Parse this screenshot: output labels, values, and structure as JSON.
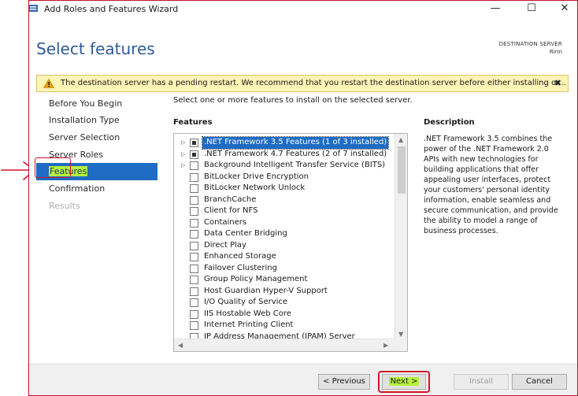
{
  "window": {
    "title": "Add Roles and Features Wizard",
    "minimize": "—",
    "maximize": "☐",
    "close": "✕"
  },
  "header": {
    "page_title": "Select features",
    "destination_label": "DESTINATION SERVER",
    "destination_name": "Ririn"
  },
  "warning": {
    "text": "The destination server has a pending restart. We recommend that you restart the destination server before either installing or...",
    "close": "✖"
  },
  "nav": {
    "items": [
      {
        "label": "Before You Begin",
        "state": "normal"
      },
      {
        "label": "Installation Type",
        "state": "normal"
      },
      {
        "label": "Server Selection",
        "state": "normal"
      },
      {
        "label": "Server Roles",
        "state": "normal"
      },
      {
        "label": "Features",
        "state": "active"
      },
      {
        "label": "Confirmation",
        "state": "normal"
      },
      {
        "label": "Results",
        "state": "disabled"
      }
    ]
  },
  "main": {
    "instruction": "Select one or more features to install on the selected server.",
    "features_header": "Features",
    "description_header": "Description",
    "description": ".NET Framework 3.5 combines the power of the .NET Framework 2.0 APIs with new technologies for building applications that offer appealing user interfaces, protect your customers' personal identity information, enable seamless and secure communication, and provide the ability to model a range of business processes.",
    "features": [
      {
        "label": ".NET Framework 3.5 Features (1 of 3 installed)",
        "expandable": true,
        "check": "partial",
        "selected": true
      },
      {
        "label": ".NET Framework 4.7 Features (2 of 7 installed)",
        "expandable": true,
        "check": "partial",
        "selected": false
      },
      {
        "label": "Background Intelligent Transfer Service (BITS)",
        "expandable": true,
        "check": "none",
        "selected": false
      },
      {
        "label": "BitLocker Drive Encryption",
        "expandable": false,
        "check": "none",
        "selected": false
      },
      {
        "label": "BitLocker Network Unlock",
        "expandable": false,
        "check": "none",
        "selected": false
      },
      {
        "label": "BranchCache",
        "expandable": false,
        "check": "none",
        "selected": false
      },
      {
        "label": "Client for NFS",
        "expandable": false,
        "check": "none",
        "selected": false
      },
      {
        "label": "Containers",
        "expandable": false,
        "check": "none",
        "selected": false
      },
      {
        "label": "Data Center Bridging",
        "expandable": false,
        "check": "none",
        "selected": false
      },
      {
        "label": "Direct Play",
        "expandable": false,
        "check": "none",
        "selected": false
      },
      {
        "label": "Enhanced Storage",
        "expandable": false,
        "check": "none",
        "selected": false
      },
      {
        "label": "Failover Clustering",
        "expandable": false,
        "check": "none",
        "selected": false
      },
      {
        "label": "Group Policy Management",
        "expandable": false,
        "check": "none",
        "selected": false
      },
      {
        "label": "Host Guardian Hyper-V Support",
        "expandable": false,
        "check": "none",
        "selected": false
      },
      {
        "label": "I/O Quality of Service",
        "expandable": false,
        "check": "none",
        "selected": false
      },
      {
        "label": "IIS Hostable Web Core",
        "expandable": false,
        "check": "none",
        "selected": false
      },
      {
        "label": "Internet Printing Client",
        "expandable": false,
        "check": "none",
        "selected": false
      },
      {
        "label": "IP Address Management (IPAM) Server",
        "expandable": false,
        "check": "none",
        "selected": false
      }
    ]
  },
  "buttons": {
    "previous": "< Previous",
    "next": "Next >",
    "install": "Install",
    "cancel": "Cancel"
  },
  "colors": {
    "accent": "#1e6cc4",
    "title_blue": "#2f5b9a",
    "highlight": "#b6f03c",
    "annotation_red": "#d3132b",
    "warning_bg": "#fff3b5"
  }
}
